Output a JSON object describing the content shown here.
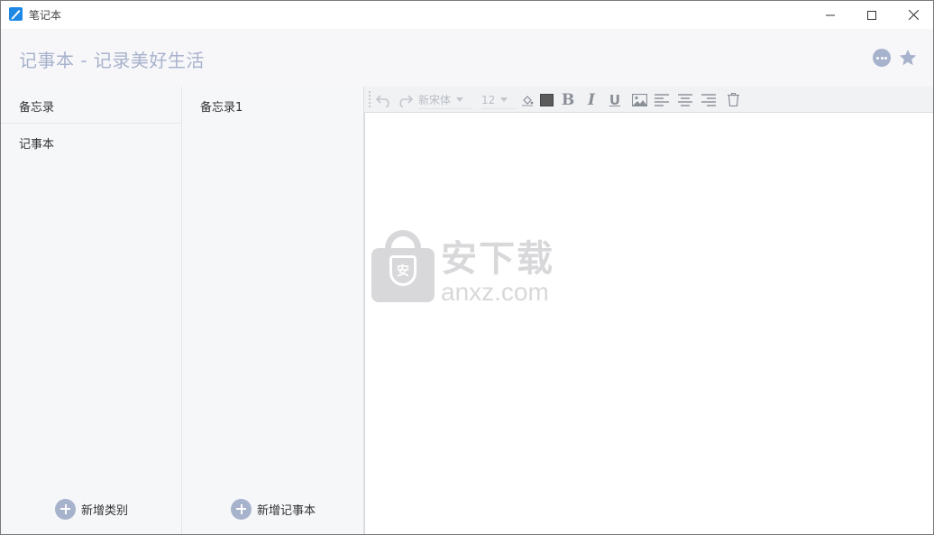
{
  "window": {
    "title": "笔记本",
    "brand_color": "#1e88e5",
    "controls": [
      "minimize-icon",
      "maximize-icon",
      "close-icon"
    ]
  },
  "header": {
    "title": "记事本 - 记录美好生活",
    "title_color": "#a7b2cc",
    "actions": [
      "more-icon",
      "star-icon"
    ]
  },
  "categories": {
    "header_label": "备忘录",
    "items": [
      {
        "label": "记事本"
      }
    ],
    "add_label": "新增类别"
  },
  "notebooks": {
    "items": [
      {
        "label": "备忘录1"
      }
    ],
    "add_label": "新增记事本"
  },
  "editor": {
    "toolbar": {
      "font_name": "新宋体",
      "font_size": "12",
      "text_color": "#5b5b5b",
      "bold_label": "B",
      "italic_label": "I",
      "underline_label": "U",
      "icons": [
        "undo-icon",
        "redo-icon",
        "fill-color-icon",
        "text-color-swatch",
        "bold-icon",
        "italic-icon",
        "underline-icon",
        "image-icon",
        "align-left-icon",
        "align-center-icon",
        "align-right-icon",
        "trash-icon"
      ]
    },
    "content": ""
  },
  "watermark": {
    "shield_text": "安",
    "text_cn": "安下载",
    "text_en": "anxz.com"
  }
}
